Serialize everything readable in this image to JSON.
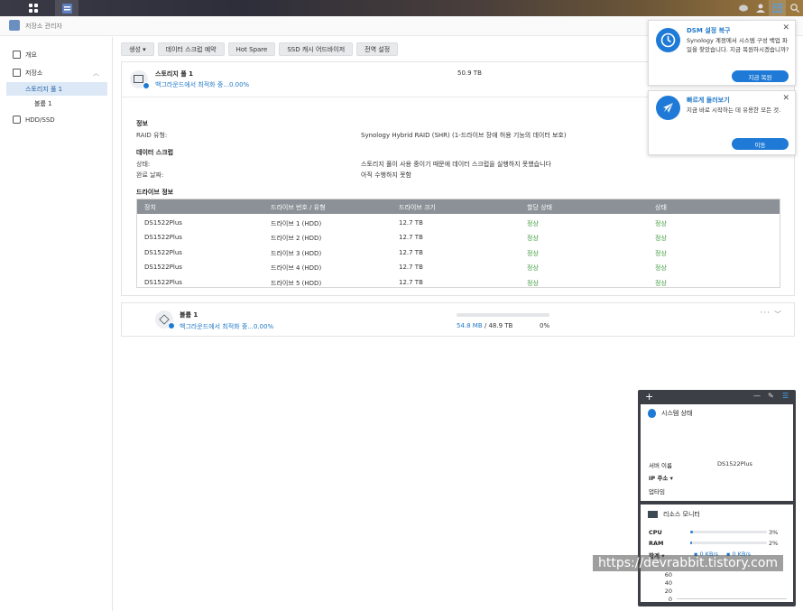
{
  "window": {
    "title": "저장소 관리자"
  },
  "sidebar": {
    "items": [
      {
        "label": "개요",
        "icon": "overview-icon"
      },
      {
        "label": "저장소",
        "icon": "storage-icon"
      },
      {
        "label": "스토리지 풀 1"
      },
      {
        "label": "볼륨 1"
      },
      {
        "label": "HDD/SSD",
        "icon": "hdd-icon"
      }
    ]
  },
  "toolbar": {
    "create": "생성 ▾",
    "scrub": "데이터 스크럽 예약",
    "hotspare": "Hot Spare",
    "ssd": "SSD 캐시 어드바이저",
    "global": "전역 설정"
  },
  "pool": {
    "title": "스토리지 풀 1",
    "status": "백그라운드에서 최적화 중...0.00%",
    "size": "50.9 TB",
    "info_heading": "정보",
    "raid_label": "RAID 유형:",
    "raid_value": "Synology Hybrid RAID (SHR) (1-드라이브 장애 허용 기능의 데이터 보호)",
    "scrub_heading": "데이터 스크럽",
    "state_label": "상태:",
    "state_value": "스토리지 풀이 사용 중이기 때문에 데이터 스크럽을 실행하지 못했습니다",
    "done_label": "완료 날짜:",
    "done_value": "아직 수행하지 못함",
    "drive_heading": "드라이브 정보",
    "columns": [
      "장치",
      "드라이브 번호 / 유형",
      "드라이브 크기",
      "할당 상태",
      "상태"
    ],
    "drives": [
      [
        "DS1522Plus",
        "드라이브 1 (HDD)",
        "12.7 TB",
        "정상",
        "정상"
      ],
      [
        "DS1522Plus",
        "드라이브 2 (HDD)",
        "12.7 TB",
        "정상",
        "정상"
      ],
      [
        "DS1522Plus",
        "드라이브 3 (HDD)",
        "12.7 TB",
        "정상",
        "정상"
      ],
      [
        "DS1522Plus",
        "드라이브 4 (HDD)",
        "12.7 TB",
        "정상",
        "정상"
      ],
      [
        "DS1522Plus",
        "드라이브 5 (HDD)",
        "12.7 TB",
        "정상",
        "정상"
      ]
    ]
  },
  "volume": {
    "title": "볼륨 1",
    "status": "백그라운드에서 최적화 중...0.00%",
    "used": "54.8 MB",
    "total": "/ 48.9 TB",
    "percent": "0%",
    "fill_fraction": 0.0
  },
  "notifications": [
    {
      "title": "DSM 설정 복구",
      "body": "Synology 계정에서 시스템 구성 백업 파일을 찾았습니다. 지금 복원하시겠습니까?",
      "button": "지금 복원"
    },
    {
      "title": "빠르게 둘러보기",
      "body": "지금 바로 시작하는 데 유용한 모든 것.",
      "button": "이동"
    }
  ],
  "widget": {
    "system_title": "시스템 상태",
    "server_label": "서버 이름",
    "server_value": "DS1522Plus",
    "ip_label": "IP 주소 ▾",
    "uptime_label": "업타임",
    "monitor_title": "리소스 모니터",
    "cpu_label": "CPU",
    "cpu_pct": "3%",
    "cpu_value": 3,
    "ram_label": "RAM",
    "ram_pct": "2%",
    "ram_value": 2,
    "net_label": "합계 ▾",
    "net_up": "0 KB/s",
    "net_down": "0 KB/s",
    "axis": [
      "60",
      "40",
      "20",
      "0"
    ]
  },
  "watermark": "https://devrabbit.tistory.com",
  "colors": {
    "accent": "#1e7ad6",
    "ok": "#3c9a3c",
    "table_header": "#8b9197"
  }
}
